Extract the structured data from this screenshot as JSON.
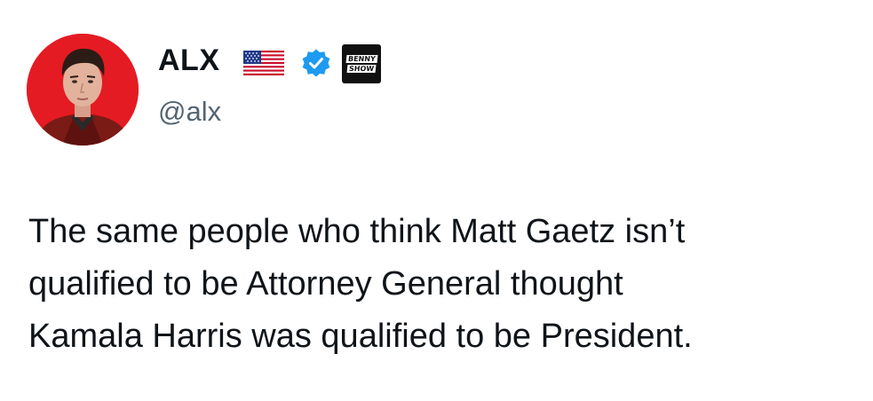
{
  "author": {
    "display_name": "ALX",
    "handle": "@alx",
    "flag_icon": "us-flag-icon",
    "verified_icon": "verified-badge-icon",
    "verified_color": "#1d9bf0",
    "affiliation_badge": {
      "line1": "BENNY",
      "line2": "SHOW"
    },
    "avatar_background": "#e41b23"
  },
  "tweet": {
    "lines": [
      "The same people who think Matt Gaetz isn’t",
      "qualified to be Attorney General thought",
      "Kamala Harris was qualified to be President."
    ]
  },
  "colors": {
    "text": "#0f1419",
    "secondary_text": "#536471"
  }
}
